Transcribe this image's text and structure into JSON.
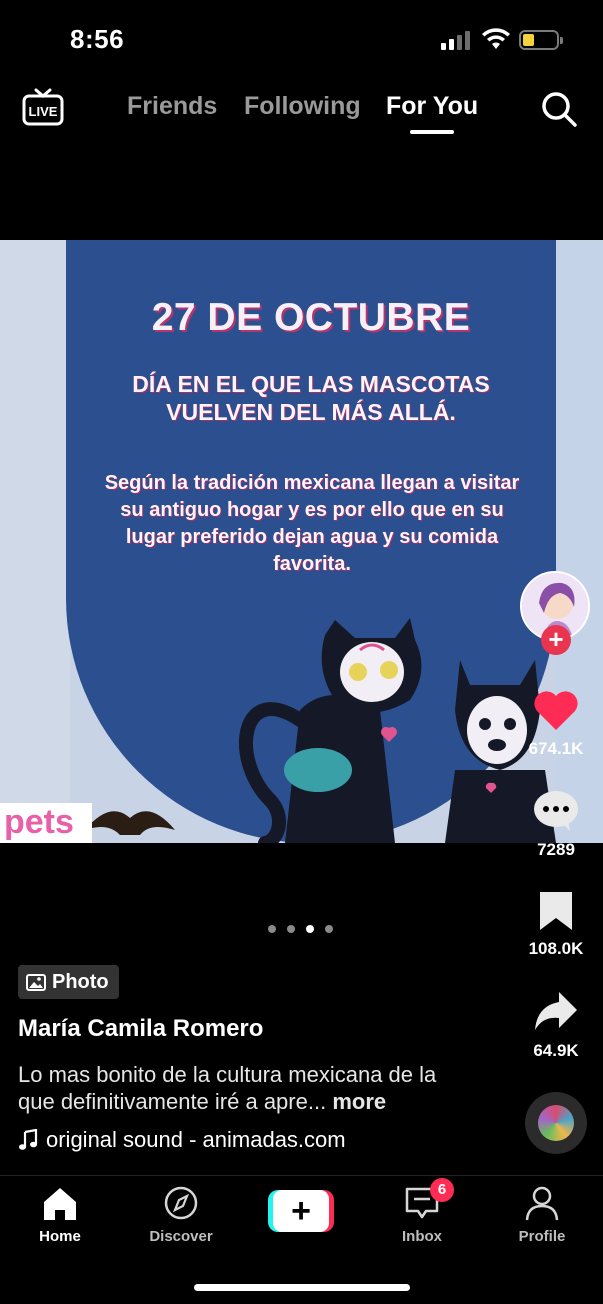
{
  "status_bar": {
    "time": "8:56"
  },
  "top_nav": {
    "live_label": "LIVE",
    "tabs": [
      {
        "label": "Friends"
      },
      {
        "label": "Following"
      },
      {
        "label": "For You"
      }
    ],
    "active_tab": "For You"
  },
  "post": {
    "heading": "27 DE OCTUBRE",
    "subheading": "DÍA EN EL QUE LAS MASCOTAS VUELVEN DEL MÁS ALLÁ.",
    "body": "Según la tradición mexicana llegan a visitar su antiguo hogar y es por ello que en su lugar preferido dejan agua y su comida favorita.",
    "logo_text": "pets",
    "carousel": {
      "total": 4,
      "active": 3
    }
  },
  "right_rail": {
    "likes": "674.1K",
    "comments": "7289",
    "saves": "108.0K",
    "shares": "64.9K"
  },
  "caption": {
    "badge": "Photo",
    "username": "María Camila Romero",
    "text": "Lo mas bonito de la cultura mexicana de la que definitivamente iré a apre...",
    "more": "more",
    "sound": "original sound - animadas.com"
  },
  "bottom_nav": {
    "items": [
      {
        "label": "Home"
      },
      {
        "label": "Discover"
      },
      {
        "label": "Inbox"
      },
      {
        "label": "Profile"
      }
    ],
    "inbox_badge": "6"
  },
  "colors": {
    "like_red": "#fe2c55",
    "panel_blue": "#2c4f8f",
    "accent_cyan": "#25f4ee"
  }
}
